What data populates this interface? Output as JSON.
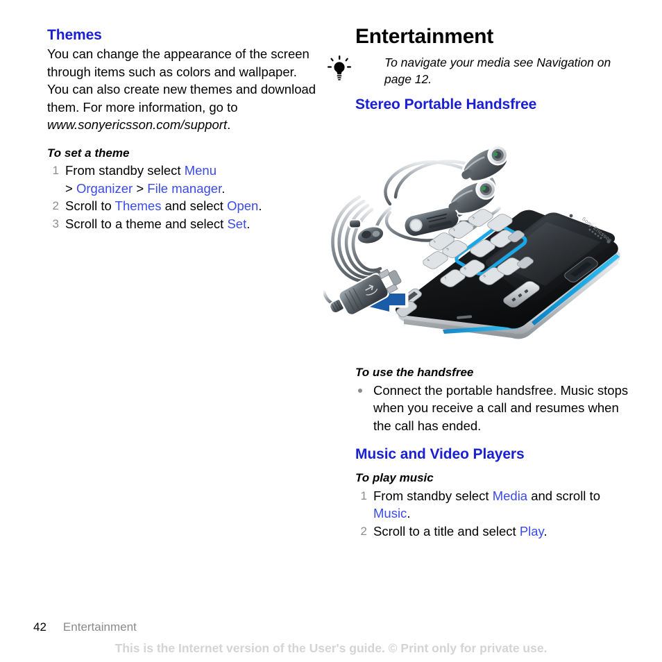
{
  "page": {
    "number": "42",
    "chapter": "Entertainment",
    "watermark": "This is the Internet version of the User's guide. © Print only for private use."
  },
  "left_column": {
    "heading": "Themes",
    "paragraph_part1": "You can change the appearance of the screen through items such as colors and wallpaper. You can also create new themes and download them. For more information, go to ",
    "paragraph_url": "www.sonyericsson.com/support",
    "paragraph_end": ".",
    "procedure_title": "To set a theme",
    "steps": [
      {
        "num": "1",
        "line1_pre": "From standby select ",
        "line1_link": "Menu",
        "line2_gt1": "> ",
        "line2_link1": "Organizer",
        "line2_gt2": " > ",
        "line2_link2": "File manager",
        "line2_end": "."
      },
      {
        "num": "2",
        "pre": "Scroll to ",
        "link1": "Themes",
        "mid": " and select ",
        "link2": "Open",
        "end": "."
      },
      {
        "num": "3",
        "pre": "Scroll to a theme and select ",
        "link1": "Set",
        "end": "."
      }
    ]
  },
  "right_column": {
    "title": "Entertainment",
    "tip": {
      "icon": "lightbulb-icon",
      "text": "To navigate your media see Navigation on page 12."
    },
    "section_handsfree": {
      "heading": "Stereo Portable Handsfree",
      "illustration": {
        "name": "phone-with-stereo-headset-illustration",
        "alt": "Sony Ericsson mobile phone with stereo portable handsfree headset being connected",
        "brand_text": "Sony Ericsson",
        "arrow": "connect-arrow"
      },
      "procedure_title": "To use the handsfree",
      "bullets": [
        "Connect the portable handsfree. Music stops when you receive a call and resumes when the call has ended."
      ]
    },
    "section_players": {
      "heading": "Music and Video Players",
      "procedure_title": "To play music",
      "steps": [
        {
          "num": "1",
          "pre": "From standby select ",
          "link1": "Media",
          "mid": " and scroll to ",
          "link2": "Music",
          "end": "."
        },
        {
          "num": "2",
          "pre": "Scroll to a title and select ",
          "link1": "Play",
          "end": "."
        }
      ]
    }
  },
  "colors": {
    "heading_blue": "#1a20d2",
    "link_blue": "#3a4ae6",
    "list_number_gray": "#8c8c8c",
    "footer_gray": "#8a8a8a",
    "watermark_gray": "#d4d4d4",
    "arrow_blue": "#1a5ca8",
    "phone_accent_cyan": "#17a2e0"
  }
}
